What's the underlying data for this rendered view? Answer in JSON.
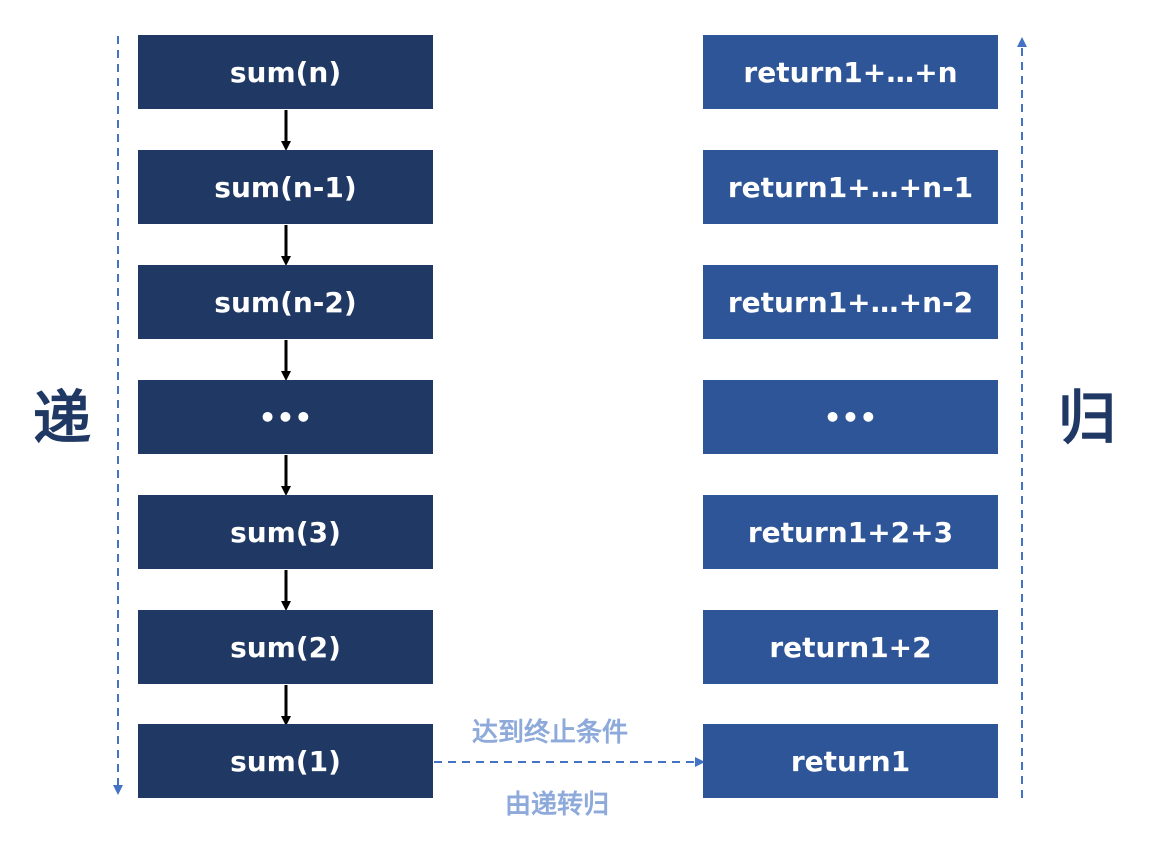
{
  "diagram": {
    "left_label": "递",
    "right_label": "归",
    "left_boxes": [
      "sum(n)",
      "sum(n-1)",
      "sum(n-2)",
      "•••",
      "sum(3)",
      "sum(2)",
      "sum(1)"
    ],
    "right_boxes": [
      "return1+…+n",
      "return1+…+n-1",
      "return1+…+n-2",
      "•••",
      "return1+2+3",
      "return1+2",
      "return1"
    ],
    "transition_top_label": "达到终止条件",
    "transition_bottom_label": "由递转归"
  },
  "colors": {
    "left_box": "#1f3864",
    "right_box": "#2e5597",
    "arrow": "#000000",
    "dashed": "#4472c4",
    "transition_text": "#8eaadb"
  }
}
